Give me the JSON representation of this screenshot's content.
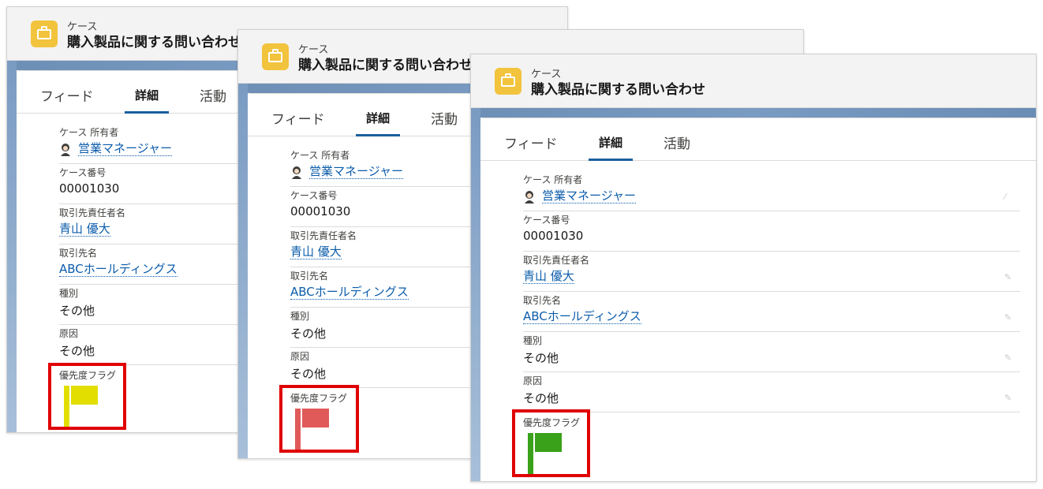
{
  "object_label": "ケース",
  "record_title": "購入製品に関する問い合わせ",
  "tabs": [
    "フィード",
    "詳細",
    "活動"
  ],
  "fields": {
    "owner_label": "ケース 所有者",
    "owner_value": "営業マネージャー",
    "case_number_label": "ケース番号",
    "case_number_value": "00001030",
    "contact_label": "取引先責任者名",
    "contact_value": "青山 優大",
    "account_label": "取引先名",
    "account_value": "ABCホールディングス",
    "type_label": "種別",
    "type_value": "その他",
    "reason_label": "原因",
    "reason_value": "その他",
    "priority_flag_label": "優先度フラグ"
  },
  "icons": {
    "case": "briefcase-icon",
    "owner": "user-avatar-icon",
    "edit": "pencil-icon"
  },
  "panels": [
    {
      "flag_color": "#e2df00"
    },
    {
      "flag_color": "#e05a5a"
    },
    {
      "flag_color": "#3aa11a"
    }
  ],
  "colors": {
    "highlight": "#e00000",
    "link": "#0b5cab",
    "tab_underline": "#1b5f9e",
    "case_icon": "#f2c33c"
  }
}
